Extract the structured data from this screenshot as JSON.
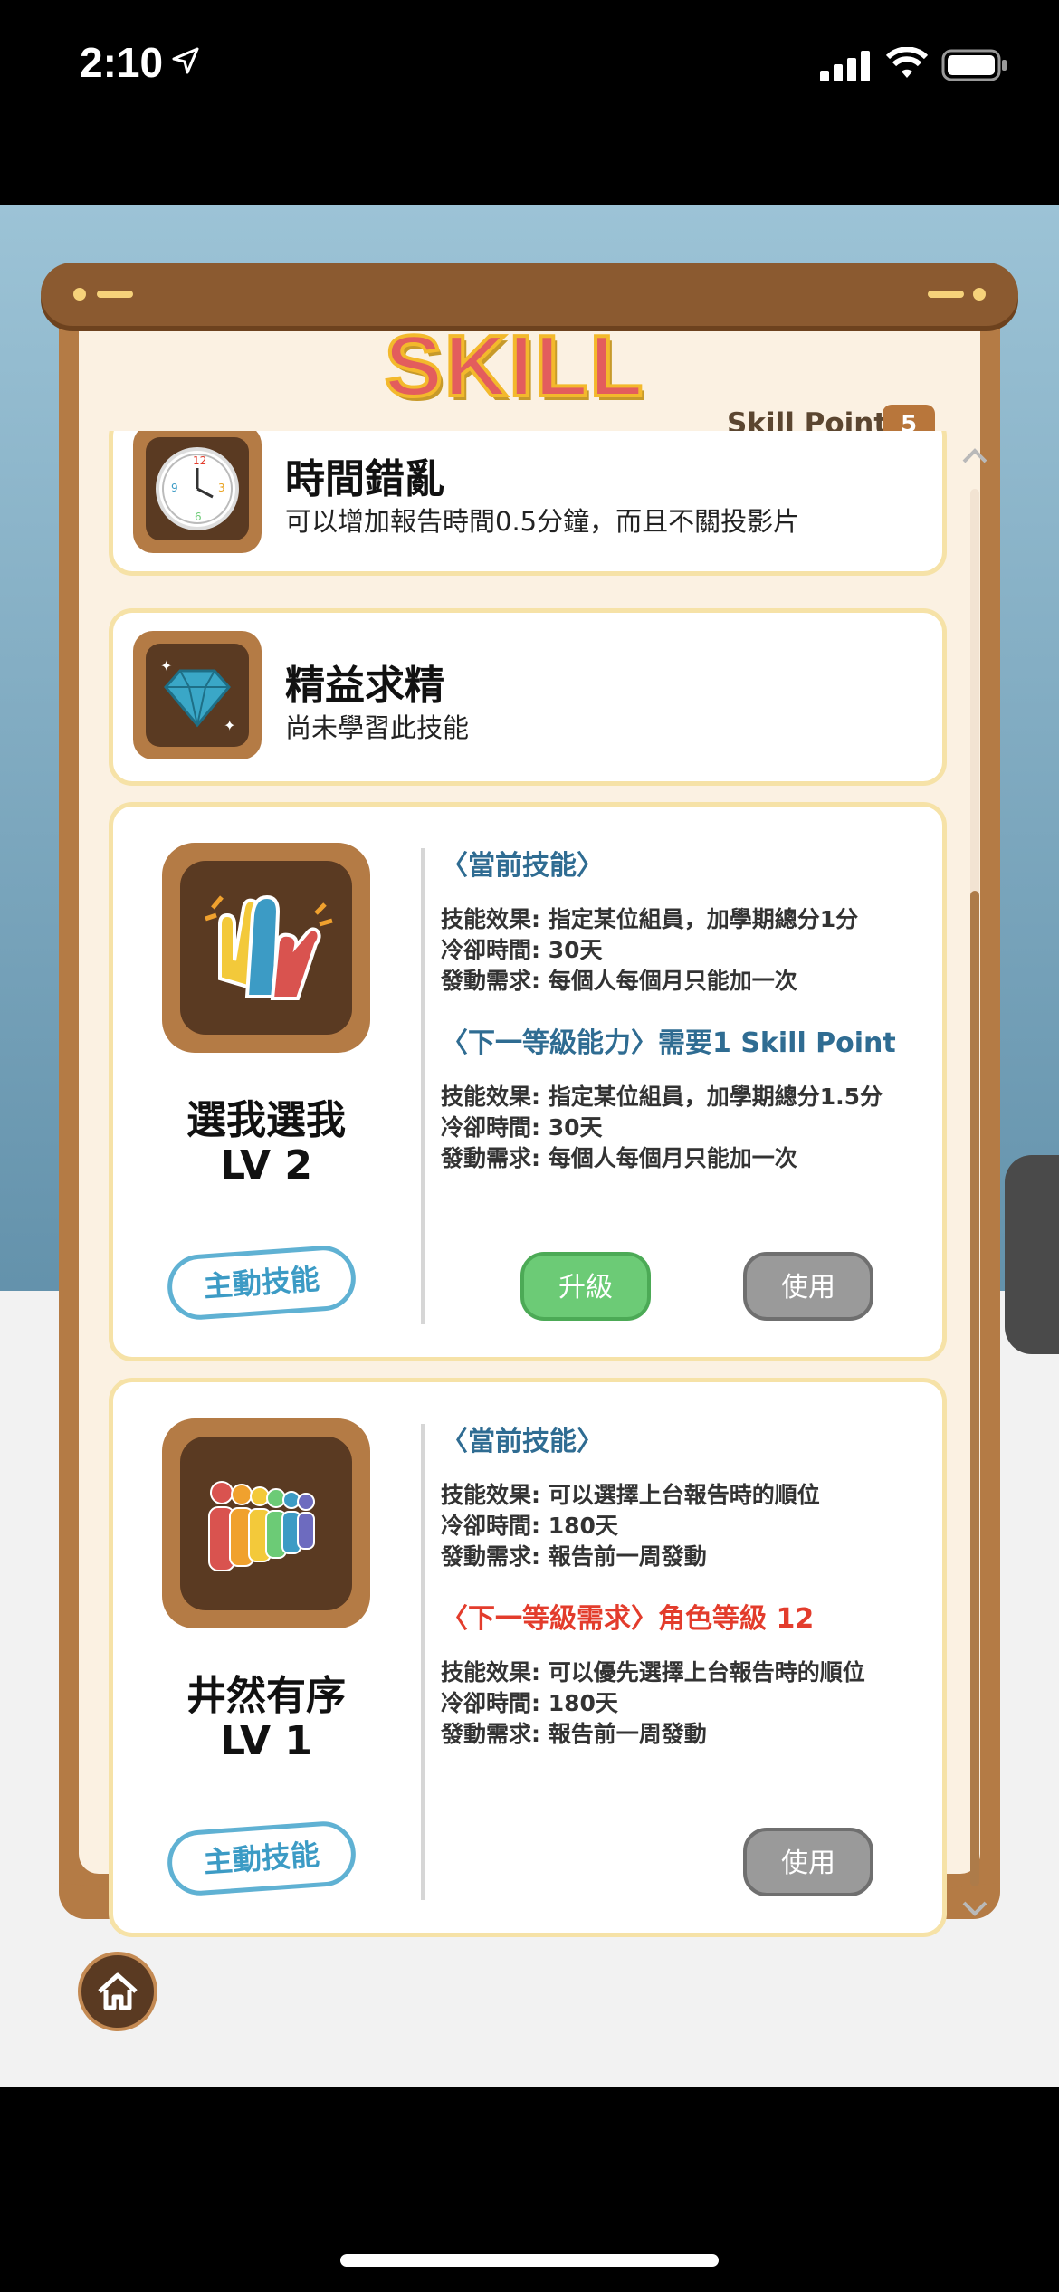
{
  "status": {
    "time": "2:10"
  },
  "header": {
    "title": "SKILL",
    "skill_point_label": "Skill Point",
    "skill_point_value": "5"
  },
  "skills": [
    {
      "name": "時間錯亂",
      "description": "可以增加報告時間0.5分鐘，而且不關投影片",
      "icon": "clock-icon"
    },
    {
      "name": "精益求精",
      "description": "尚未學習此技能",
      "icon": "diamond-icon"
    },
    {
      "name": "選我選我",
      "level": "LV 2",
      "icon": "raised-hands-icon",
      "tag": "主動技能",
      "current_title": "〈當前技能〉",
      "current_lines": [
        "技能效果: 指定某位組員，加學期總分1分",
        "冷卻時間: 30天",
        "發動需求: 每個人每個月只能加一次"
      ],
      "next_title": "〈下一等級能力〉需要1 Skill Point",
      "next_lines": [
        "技能效果: 指定某位組員，加學期總分1.5分",
        "冷卻時間: 30天",
        "發動需求: 每個人每個月只能加一次"
      ],
      "upgrade_label": "升級",
      "use_label": "使用"
    },
    {
      "name": "井然有序",
      "level": "LV 1",
      "icon": "people-line-icon",
      "tag": "主動技能",
      "current_title": "〈當前技能〉",
      "current_lines": [
        "技能效果: 可以選擇上台報告時的順位",
        "冷卻時間: 180天",
        "發動需求: 報告前一周發動"
      ],
      "next_title": "〈下一等級需求〉角色等級 12",
      "next_lines": [
        "技能效果: 可以優先選擇上台報告時的順位",
        "冷卻時間: 180天",
        "發動需求: 報告前一周發動"
      ],
      "use_label": "使用"
    }
  ],
  "colors": {
    "accent_blue": "#2f6c92",
    "warning_red": "#e33c2c",
    "upgrade_green": "#6ccb76",
    "wood": "#b47b45"
  }
}
